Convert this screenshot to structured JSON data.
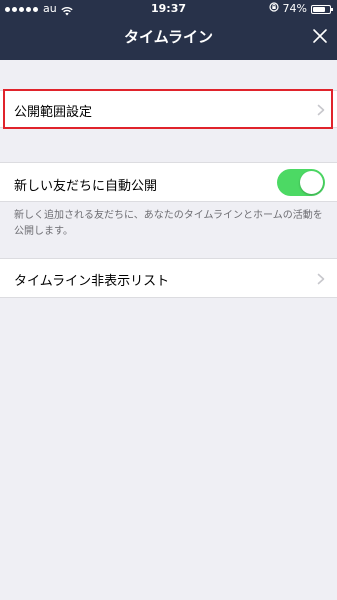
{
  "status_bar": {
    "carrier": "au",
    "time": "19:37",
    "battery_text": "74%",
    "battery_level": 0.74
  },
  "nav": {
    "title": "タイムライン"
  },
  "settings": {
    "privacy_label": "公開範囲設定",
    "auto_public_label": "新しい友だちに自動公開",
    "auto_public_enabled": true,
    "auto_public_description": "新しく追加される友だちに、あなたのタイムラインとホームの活動を公開します。",
    "hidden_list_label": "タイムライン非表示リスト"
  },
  "colors": {
    "header_bg": "#28324a",
    "page_bg": "#efeff4",
    "toggle_on": "#4cd964",
    "highlight": "#e0232b"
  }
}
